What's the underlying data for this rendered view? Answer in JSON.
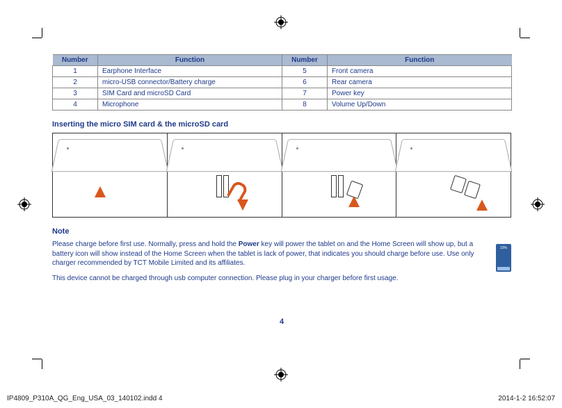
{
  "table": {
    "headers": {
      "num": "Number",
      "fn": "Function"
    },
    "rows": [
      {
        "n1": "1",
        "f1": "Earphone Interface",
        "n2": "5",
        "f2": "Front camera"
      },
      {
        "n1": "2",
        "f1": "micro-USB connector/Battery charge",
        "n2": "6",
        "f2": "Rear camera"
      },
      {
        "n1": "3",
        "f1": "SIM Card and microSD Card",
        "n2": "7",
        "f2": "Power key"
      },
      {
        "n1": "4",
        "f1": "Microphone",
        "n2": "8",
        "f2": "Volume Up/Down"
      }
    ]
  },
  "section_title": "Inserting the micro SIM card & the microSD card",
  "note": {
    "heading": "Note",
    "body_pre": "Please charge before first use. Normally, press and hold the ",
    "body_bold": "Power",
    "body_post": " key will power the tablet on and the Home Screen will show up, but a battery icon will show instead of the Home Screen when the tablet is lack of power, that indicates you should charge before use. Use only charger recommended by TCT Mobile Limited and its affiliates.",
    "body2": "This device cannot be charged through usb computer connection. Please plug in your charger before first usage."
  },
  "page_number": "4",
  "footer": {
    "file": "IP4809_P310A_QG_Eng_USA_03_140102.indd   4",
    "timestamp": "2014-1-2   16:52:07"
  }
}
